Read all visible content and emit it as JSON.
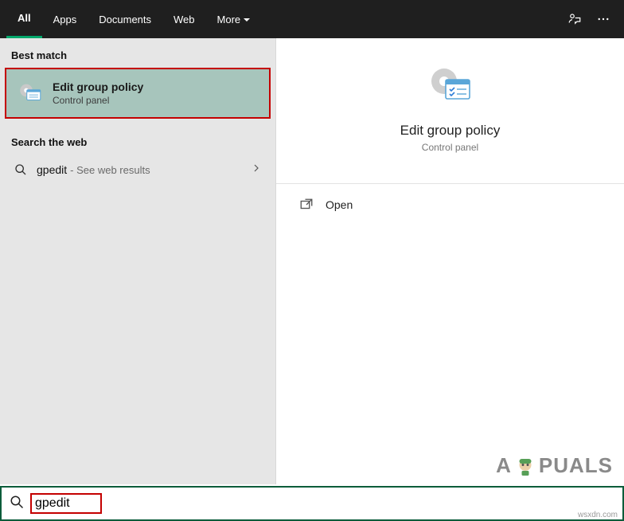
{
  "tabs": {
    "all": "All",
    "apps": "Apps",
    "documents": "Documents",
    "web": "Web",
    "more": "More"
  },
  "left": {
    "best_match_header": "Best match",
    "result": {
      "title": "Edit group policy",
      "subtitle": "Control panel"
    },
    "search_web_header": "Search the web",
    "web_query": "gpedit",
    "web_hint": "- See web results"
  },
  "detail": {
    "title": "Edit group policy",
    "subtitle": "Control panel",
    "open": "Open"
  },
  "watermark": {
    "prefix": "A",
    "suffix": "PUALS"
  },
  "search": {
    "value": "gpedit"
  },
  "site": "wsxdn.com"
}
